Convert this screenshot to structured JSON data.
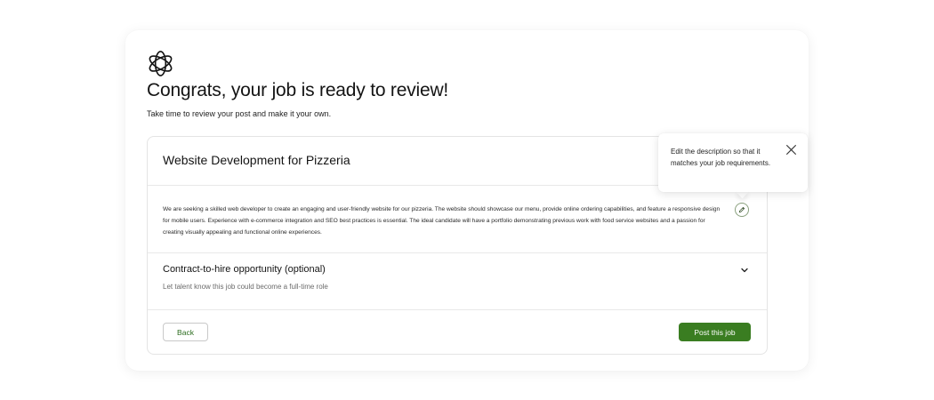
{
  "header": {
    "logo_icon": "flower-logo-icon",
    "title": "Congrats, your job is ready to review!",
    "subtitle": "Take time to review your post and make it your own."
  },
  "job": {
    "title": "Website Development for Pizzeria",
    "description": "We are seeking a skilled web developer to create an engaging and user-friendly website for our pizzeria. The website should showcase our menu, provide online ordering capabilities, and feature a responsive design for mobile users. Experience with e-commerce integration and SEO best practices is essential. The ideal candidate will have a portfolio demonstrating previous work with food service websites and a passion for creating visually appealing and functional online experiences.",
    "edit_icon": "pencil-icon"
  },
  "contract": {
    "title": "Contract-to-hire opportunity (optional)",
    "subtitle": "Let talent know this job could become a full-time role",
    "toggle_icon": "chevron-down-icon"
  },
  "footer": {
    "back_label": "Back",
    "post_label": "Post this job"
  },
  "tooltip": {
    "text": "Edit the description so that it matches your job requirements.",
    "close_icon": "close-icon"
  },
  "colors": {
    "accent": "#3a7d21",
    "border": "#e4e4e4"
  }
}
